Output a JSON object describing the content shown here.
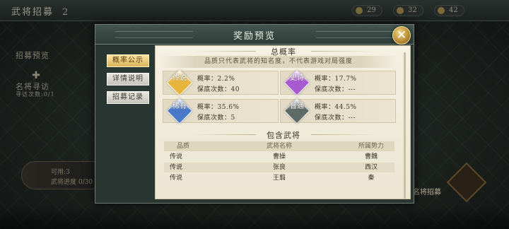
{
  "background": {
    "title": "武将招募",
    "title_number": "2",
    "resources": [
      "29",
      "32",
      "42"
    ],
    "side_items": [
      "招募预览",
      "名将寻访",
      "寻访次数:0/1"
    ],
    "bottom_card": {
      "line1": "可用:3",
      "line2": "武将进度 0/30"
    },
    "right_button_label": "名将招募"
  },
  "modal": {
    "title": "奖励预览",
    "close_icon": "close-x-icon"
  },
  "tabs": [
    {
      "label": "概率公示",
      "active": true
    },
    {
      "label": "详情说明",
      "active": false
    },
    {
      "label": "招募记录",
      "active": false
    }
  ],
  "probability": {
    "section_title": "总概率",
    "note": "品质只代表武将的知名度，不代表游戏对局强度",
    "rate_label": "概率：",
    "pity_label": "保底次数：",
    "qualities": [
      {
        "name": "传说",
        "rate": "2.2%",
        "pity": "40",
        "color": "#e8b53c"
      },
      {
        "name": "史诗",
        "rate": "17.7%",
        "pity": "---",
        "color": "#a85ad0"
      },
      {
        "name": "稀有",
        "rate": "35.6%",
        "pity": "5",
        "color": "#4a78c8"
      },
      {
        "name": "普通",
        "rate": "44.5%",
        "pity": "---",
        "color": "#5d6a66"
      }
    ]
  },
  "generals": {
    "section_title": "包含武将",
    "columns": [
      "品质",
      "武将名称",
      "所属势力"
    ],
    "rows": [
      {
        "quality": "传说",
        "name": "曹操",
        "faction": "曹魏"
      },
      {
        "quality": "传说",
        "name": "张良",
        "faction": "西汉"
      },
      {
        "quality": "传说",
        "name": "王翦",
        "faction": "秦"
      }
    ]
  }
}
